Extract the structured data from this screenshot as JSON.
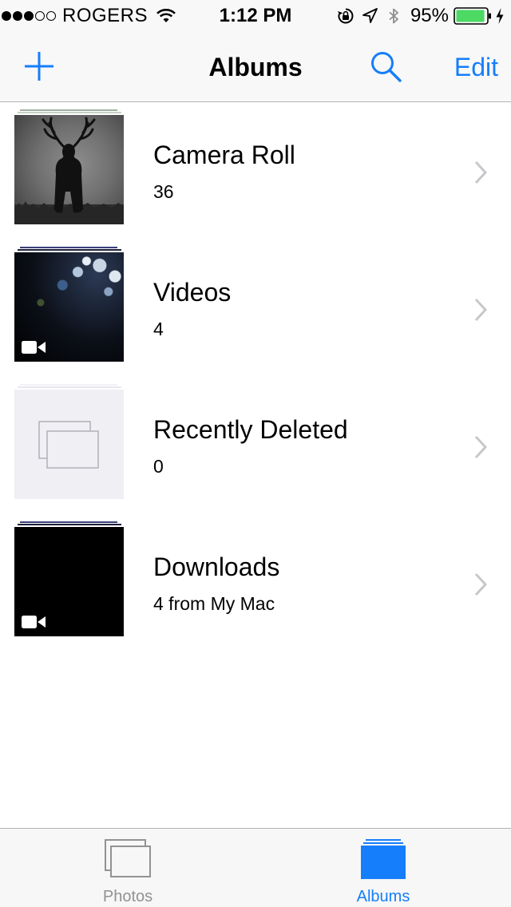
{
  "status_bar": {
    "signal_filled": 3,
    "signal_total": 5,
    "carrier": "ROGERS",
    "wifi_icon": "wifi-icon",
    "time": "1:12 PM",
    "rotation_lock_icon": "rotation-lock-icon",
    "location_icon": "location-arrow-icon",
    "bluetooth_icon": "bluetooth-icon",
    "battery_percent": "95%",
    "battery_level": 0.95,
    "battery_color": "#4cd964",
    "charging_icon": "lightning-bolt-icon"
  },
  "nav": {
    "title": "Albums",
    "add_icon": "plus-icon",
    "search_icon": "search-icon",
    "edit_label": "Edit",
    "accent_color": "#157efb"
  },
  "albums": [
    {
      "name": "Camera Roll",
      "count": "36",
      "thumbnail": "deer-silhouette-photo",
      "is_video": false
    },
    {
      "name": "Videos",
      "count": "4",
      "thumbnail": "dark-bokeh-video-frame",
      "is_video": true
    },
    {
      "name": "Recently Deleted",
      "count": "0",
      "thumbnail": "empty-album-placeholder",
      "is_video": false
    },
    {
      "name": "Downloads",
      "count": "4 from My Mac",
      "thumbnail": "black-video-frame",
      "is_video": true
    }
  ],
  "tab_bar": {
    "tabs": [
      {
        "label": "Photos",
        "icon": "photos-tab-icon",
        "selected": false
      },
      {
        "label": "Albums",
        "icon": "albums-tab-icon",
        "selected": true
      }
    ]
  }
}
